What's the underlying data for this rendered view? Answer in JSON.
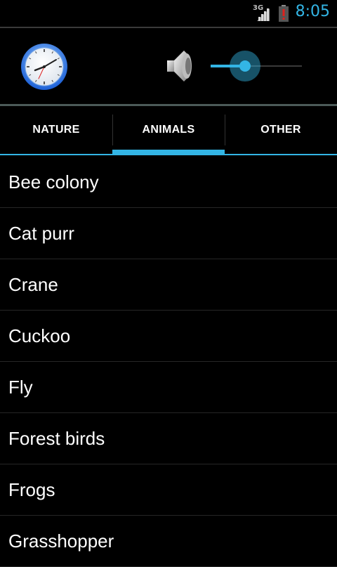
{
  "status_bar": {
    "network_label": "3G",
    "time": "8:05",
    "icons": [
      "signal-icon",
      "battery-alert-icon"
    ]
  },
  "controls": {
    "clock_icon": "analog-clock-icon",
    "speaker_icon": "speaker-icon",
    "volume_level": 0.38
  },
  "tabs": [
    {
      "label": "NATURE",
      "selected": false
    },
    {
      "label": "ANIMALS",
      "selected": true
    },
    {
      "label": "OTHER",
      "selected": false
    }
  ],
  "sounds": [
    "Bee colony",
    "Cat purr",
    "Crane",
    "Cuckoo",
    "Fly",
    "Forest birds",
    "Frogs",
    "Grasshopper"
  ],
  "colors": {
    "accent": "#33b5e5",
    "background": "#000000",
    "divider": "#262626"
  }
}
